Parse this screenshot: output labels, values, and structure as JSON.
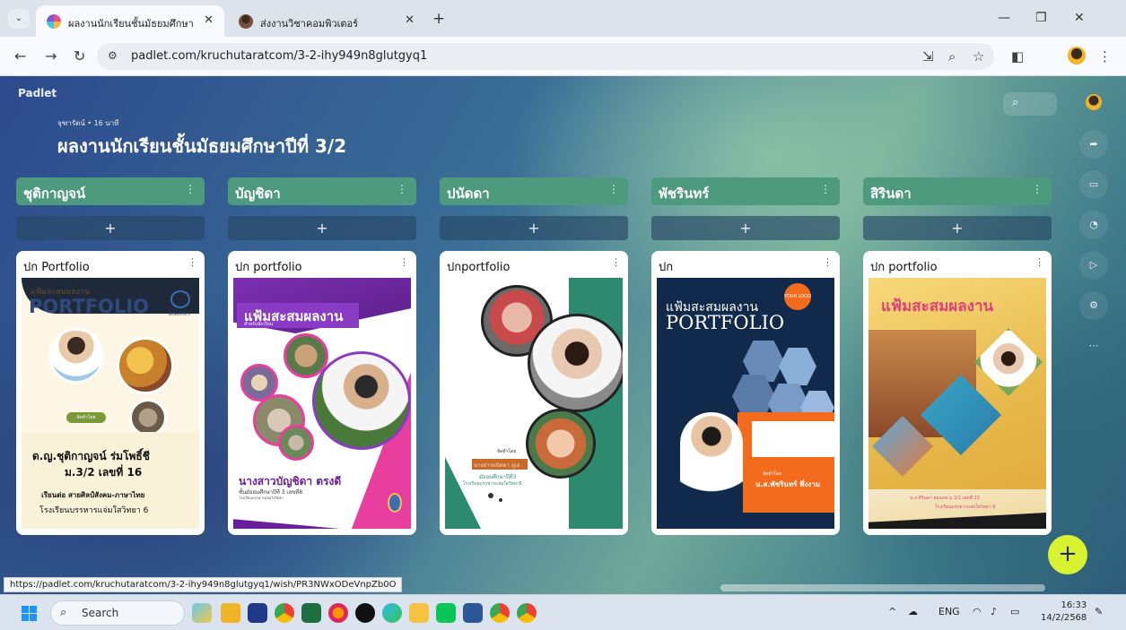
{
  "browser": {
    "tabs": [
      {
        "title": "ผลงานนักเรียนชั้นมัธยมศึกษาปีที่ 3/2",
        "active": true
      },
      {
        "title": "ส่งงานวิชาคอมพิวเตอร์",
        "active": false
      }
    ],
    "url": "padlet.com/kruchutaratcom/3-2-ihy949n8glutgyq1",
    "status_url": "https://padlet.com/kruchutaratcom/3-2-ihy949n8glutgyq1/wish/PR3NWxODeVnpZb0O"
  },
  "padlet": {
    "logo": "Padlet",
    "meta": "จุฑารัตน์ • 16 นาที",
    "title": "ผลงานนักเรียนชั้นมัธยมศึกษาปีที่ 3/2",
    "add_label": "+",
    "fab_label": "+",
    "columns": [
      {
        "name": "ชุติกาญจน์",
        "card_title": "ปก Portfolio",
        "cover": {
          "line1": "แฟ้มสะสมผลงาน",
          "line2": "PORTFOLIO",
          "school_badge": "BANHARN 6",
          "tag": "จัดทำโดย",
          "name": "ด.ญ.ชุติกาญจน์ ร่มโพธิ์ชี",
          "class": "ม.3/2 เลขที่ 16",
          "program": "เรียนต่อ สายศิลป์สังคม-ภาษาไทย",
          "school": "โรงเรียนบรรหารแจ่มใสวิทยา 6"
        }
      },
      {
        "name": "บัญชิดา",
        "card_title": "ปก portfolio",
        "cover": {
          "line1": "แฟ้มสะสมผลงาน",
          "sub": "สำหรับนักเรียน",
          "name": "นางสาวบัญชิดา ตรงดี",
          "class": "ชั้นมัธยมศึกษาปีที่ 3 เลขที่8",
          "school": "โรงเรียนบรรหารแจ่มใสวิทยา"
        }
      },
      {
        "name": "ปนัดดา",
        "card_title": "ปกportfolio",
        "cover": {
          "tag": "จัดทำโดย",
          "name": "นางสาวปนัดดา ภูเล",
          "class": "มัธยมศึกษาปีที่3",
          "school": "โรงเรียนบรรหารแจ่มใสวิทยา6"
        }
      },
      {
        "name": "พัชรินทร์",
        "card_title": "ปก",
        "cover": {
          "line1": "แฟ้มสะสมผลงาน",
          "line2": "PORTFOLIO",
          "logo": "YOUR LOGO",
          "tag": "จัดทำโดย",
          "name": "น.ส.พัชรินทร์ พึ่งงาม"
        }
      },
      {
        "name": "สิรินดา",
        "card_title": "ปก portfolio",
        "cover": {
          "line1": "แฟ้มสะสมผลงาน",
          "name": "น.ส.สิรินดา สอนบท ม.3/2 เลขที่ 23",
          "school": "โรงเรียนบรรหารแจ่มใสวิทยา 6"
        }
      }
    ]
  },
  "taskbar": {
    "search_label": "Search",
    "lang": "ENG",
    "time": "16:33",
    "date": "14/2/2568"
  }
}
